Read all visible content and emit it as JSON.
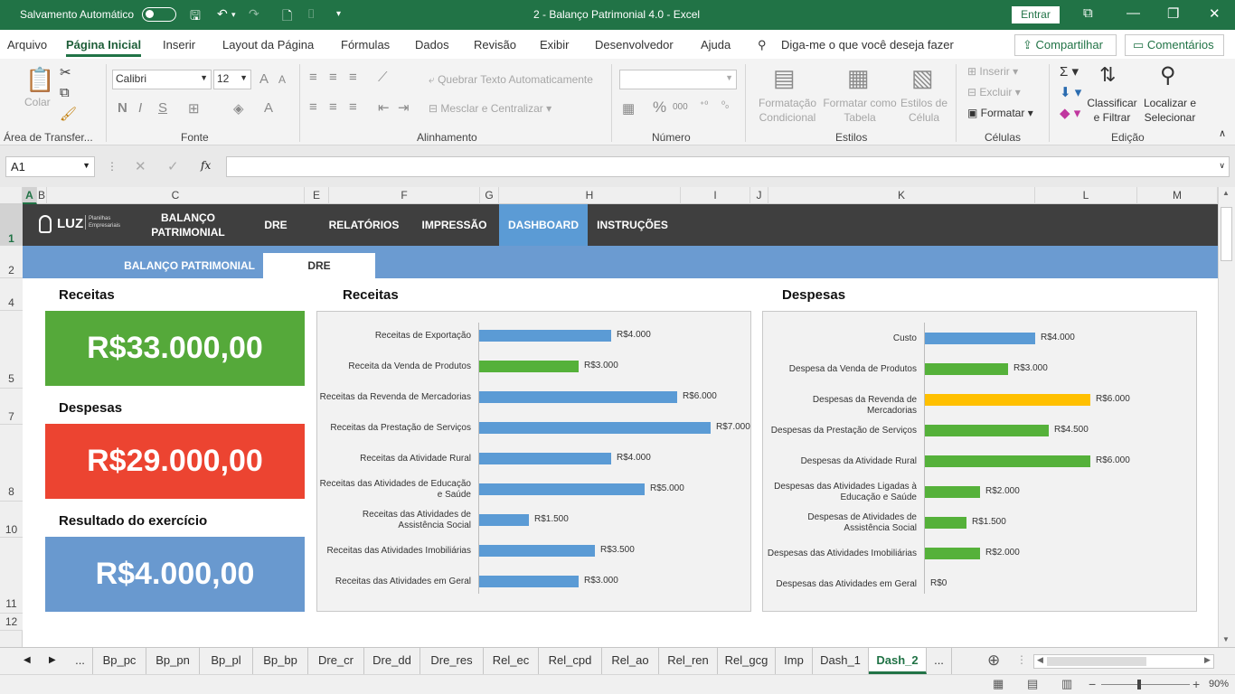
{
  "titlebar": {
    "autosave_label": "Salvamento Automático",
    "doc_title": "2 - Balanço Patrimonial 4.0  -  Excel",
    "signin_label": "Entrar"
  },
  "menu": {
    "tabs": [
      "Arquivo",
      "Página Inicial",
      "Inserir",
      "Layout da Página",
      "Fórmulas",
      "Dados",
      "Revisão",
      "Exibir",
      "Desenvolvedor",
      "Ajuda"
    ],
    "active": "Página Inicial",
    "tell_me": "Diga-me o que você deseja fazer",
    "share": "Compartilhar",
    "comments": "Comentários"
  },
  "ribbon": {
    "clipboard": {
      "paste": "Colar",
      "label": "Área de Transfer..."
    },
    "font": {
      "name": "Calibri",
      "size": "12",
      "label": "Fonte"
    },
    "alignment": {
      "wrap": "Quebrar Texto Automaticamente",
      "merge": "Mesclar e Centralizar",
      "label": "Alinhamento"
    },
    "number": {
      "label": "Número"
    },
    "styles": {
      "cond": "Formatação Condicional",
      "table": "Formatar como Tabela",
      "cell": "Estilos de Célula",
      "label": "Estilos"
    },
    "cells": {
      "insert": "Inserir",
      "delete": "Excluir",
      "format": "Formatar",
      "label": "Células"
    },
    "editing": {
      "sort": "Classificar e Filtrar",
      "find": "Localizar e Selecionar",
      "label": "Edição"
    }
  },
  "formula_bar": {
    "name_box": "A1",
    "fx": "fx",
    "formula": ""
  },
  "columns": [
    "A",
    "B",
    "C",
    "E",
    "F",
    "G",
    "H",
    "I",
    "J",
    "K",
    "L",
    "M"
  ],
  "rows": [
    "1",
    "2",
    "4",
    "5",
    "7",
    "8",
    "10",
    "11",
    "12"
  ],
  "nav": {
    "logo": "LUZ",
    "logo_sub": "Planilhas Empresariais",
    "items": [
      "BALANÇO PATRIMONIAL",
      "DRE",
      "RELATÓRIOS",
      "IMPRESSÃO",
      "DASHBOARD",
      "INSTRUÇÕES"
    ],
    "active": "DASHBOARD"
  },
  "subnav": {
    "items": [
      "BALANÇO PATRIMONIAL",
      "DRE"
    ],
    "active": "DRE"
  },
  "kpis": {
    "receitas_title": "Receitas",
    "receitas_value": "R$33.000,00",
    "despesas_title": "Despesas",
    "despesas_value": "R$29.000,00",
    "resultado_title": "Resultado do exercício",
    "resultado_value": "R$4.000,00",
    "colors": {
      "receitas": "#55a93a",
      "despesas": "#ec4431",
      "resultado": "#6999cf"
    }
  },
  "chart_data": [
    {
      "type": "bar",
      "title": "Receitas",
      "orientation": "horizontal",
      "categories": [
        "Receitas de Exportação",
        "Receita da Venda de Produtos",
        "Receitas da Revenda de Mercadorias",
        "Receitas da Prestação de Serviços",
        "Receitas da Atividade Rural",
        "Receitas das Atividades de Educação e Saúde",
        "Receitas das Atividades de Assistência Social",
        "Receitas das Atividades Imobiliárias",
        "Receitas das Atividades em Geral"
      ],
      "values": [
        4000,
        3000,
        6000,
        7000,
        4000,
        5000,
        1500,
        3500,
        3000
      ],
      "labels": [
        "R$4.000",
        "R$3.000",
        "R$6.000",
        "R$7.000",
        "R$4.000",
        "R$5.000",
        "R$1.500",
        "R$3.500",
        "R$3.000"
      ],
      "colors": [
        "#5b9bd5",
        "#55b13a",
        "#5b9bd5",
        "#5b9bd5",
        "#5b9bd5",
        "#5b9bd5",
        "#5b9bd5",
        "#5b9bd5",
        "#5b9bd5"
      ],
      "xlim": [
        0,
        7000
      ]
    },
    {
      "type": "bar",
      "title": "Despesas",
      "orientation": "horizontal",
      "categories": [
        "Custo",
        "Despesa da Venda de Produtos",
        "Despesas da Revenda de Mercadorias",
        "Despesas da Prestação de Serviços",
        "Despesas da Atividade Rural",
        "Despesas das Atividades Ligadas à Educação e Saúde",
        "Despesas de Atividades de Assistência Social",
        "Despesas das Atividades Imobiliárias",
        "Despesas das Atividades em Geral"
      ],
      "values": [
        4000,
        3000,
        6000,
        4500,
        6000,
        2000,
        1500,
        2000,
        0
      ],
      "labels": [
        "R$4.000",
        "R$3.000",
        "R$6.000",
        "R$4.500",
        "R$6.000",
        "R$2.000",
        "R$1.500",
        "R$2.000",
        "R$0"
      ],
      "colors": [
        "#5b9bd5",
        "#55b13a",
        "#ffc000",
        "#55b13a",
        "#55b13a",
        "#55b13a",
        "#55b13a",
        "#55b13a",
        "#55b13a"
      ],
      "xlim": [
        0,
        6000
      ]
    }
  ],
  "sheet_tabs": {
    "items": [
      "...",
      "Bp_pc",
      "Bp_pn",
      "Bp_pl",
      "Bp_bp",
      "Dre_cr",
      "Dre_dd",
      "Dre_res",
      "Rel_ec",
      "Rel_cpd",
      "Rel_ao",
      "Rel_ren",
      "Rel_gcg",
      "Imp",
      "Dash_1",
      "Dash_2",
      "..."
    ],
    "active": "Dash_2"
  },
  "status": {
    "zoom": "90%"
  }
}
